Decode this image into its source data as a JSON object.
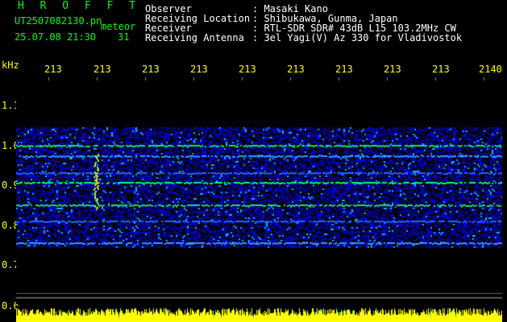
{
  "header": {
    "app_title": "H R O F F T",
    "filename": "UT2507082130.pn",
    "meteor": "meteor",
    "datetime": "25.07.08 21:30",
    "count": "31"
  },
  "info": [
    {
      "label": "Observer",
      "value": ": Masaki Kano"
    },
    {
      "label": "Receiving Location",
      "value": ": Shibukawa, Gunma, Japan"
    },
    {
      "label": "Receiver",
      "value": ": RTL-SDR SDR# 43dB L15 103.2MHz CW"
    },
    {
      "label": "Receiving Antenna",
      "value": ": 3el Yagi(V) Az 330 for Vladivostok"
    }
  ],
  "axis": {
    "y_unit": "kHz",
    "y_ticks": [
      "1.1",
      "1.0",
      "0.9",
      "0.8",
      "0.7",
      "0.6"
    ],
    "x_ticks": [
      "213",
      "213",
      "213",
      "213",
      "213",
      "213",
      "213",
      "213",
      "213",
      "2140"
    ]
  },
  "colors": {
    "text_info": "#ffffff",
    "text_title": "#00ff00",
    "axis_label": "#ffff00",
    "signal": "#00ff66"
  }
}
